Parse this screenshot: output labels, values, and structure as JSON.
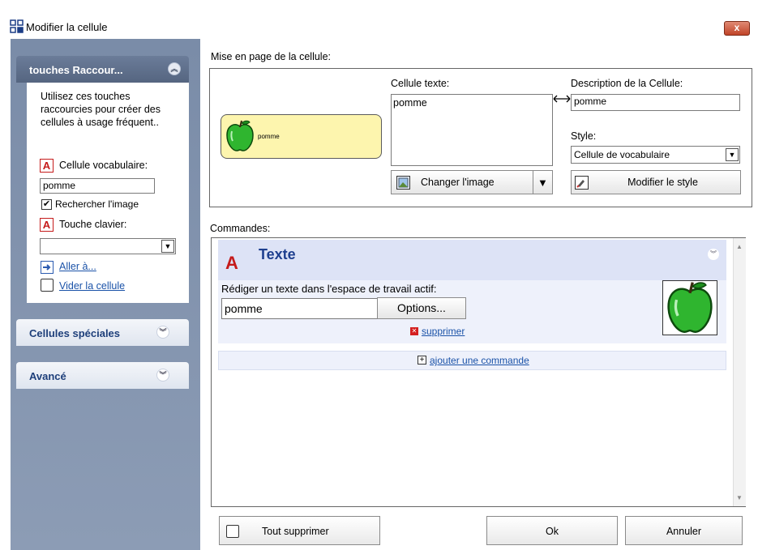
{
  "window": {
    "title": "Modifier la cellule",
    "close_label": "x"
  },
  "left_panel": {
    "shortcuts": {
      "header": "touches Raccour...",
      "help": "Utilisez ces touches raccourcies pour créer des cellules à usage fréquent..",
      "vocab_label": "Cellule vocabulaire:",
      "vocab_value": "pomme",
      "find_image_label": "Rechercher l'image",
      "find_image_checked": "✔",
      "key_label": "Touche clavier:",
      "key_value": "",
      "goto_label": "Aller à...",
      "clear_label": "Vider la cellule"
    },
    "special_cells": {
      "header": "Cellules spéciales"
    },
    "advanced": {
      "header": "Avancé"
    }
  },
  "layout": {
    "group_label": "Mise en page de la cellule:",
    "preview_text": "pomme",
    "cell_text_label": "Cellule texte:",
    "cell_text_value": "pomme",
    "description_label": "Description de la Cellule:",
    "description_value": "pomme",
    "style_label": "Style:",
    "style_value": "Cellule de vocabulaire",
    "change_image_label": "Changer l'image",
    "modify_style_label": "Modifier le style"
  },
  "commands": {
    "group_label": "Commandes:",
    "items": [
      {
        "title": "Texte",
        "description": "Rédiger un texte dans l'espace de travail actif:",
        "value": "pomme",
        "options_label": "Options...",
        "delete_label": "supprimer"
      }
    ],
    "add_label": "ajouter une commande"
  },
  "footer": {
    "delete_all_label": "Tout supprimer",
    "ok_label": "Ok",
    "cancel_label": "Annuler"
  },
  "colors": {
    "accent": "#1a52a8",
    "panel_bg": "#8c9cb5",
    "cell_yellow": "#fdf5ae",
    "command_header": "#dde3f6"
  }
}
